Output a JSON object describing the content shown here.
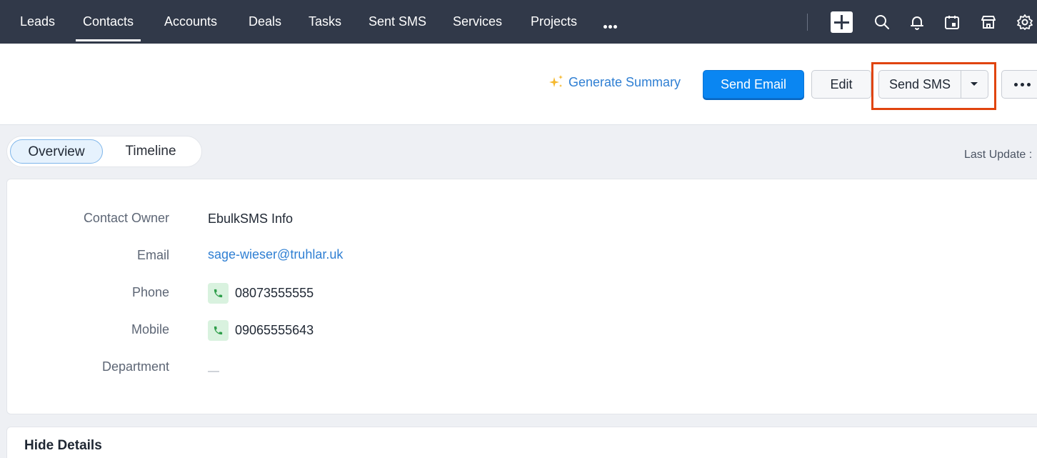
{
  "nav": {
    "items": [
      {
        "label": "Leads",
        "active": false
      },
      {
        "label": "Contacts",
        "active": true
      },
      {
        "label": "Accounts",
        "active": false
      },
      {
        "label": "Deals",
        "active": false
      },
      {
        "label": "Tasks",
        "active": false
      },
      {
        "label": "Sent SMS",
        "active": false
      },
      {
        "label": "Services",
        "active": false
      },
      {
        "label": "Projects",
        "active": false
      }
    ],
    "icons": [
      "plus-icon",
      "search-icon",
      "bell-icon",
      "calendar-icon",
      "marketplace-icon",
      "gear-icon"
    ]
  },
  "header": {
    "generate_summary": "Generate Summary",
    "send_email": "Send Email",
    "edit": "Edit",
    "send_sms": "Send SMS"
  },
  "tabs": {
    "overview": "Overview",
    "timeline": "Timeline"
  },
  "last_update_label": "Last Update :",
  "details": {
    "contact_owner": {
      "label": "Contact Owner",
      "value": "EbulkSMS Info"
    },
    "email": {
      "label": "Email",
      "value": "sage-wieser@truhlar.uk"
    },
    "phone": {
      "label": "Phone",
      "value": "08073555555"
    },
    "mobile": {
      "label": "Mobile",
      "value": "09065555643"
    },
    "department": {
      "label": "Department",
      "value": "—"
    }
  },
  "hide_details": "Hide Details",
  "colors": {
    "nav_bg": "#313949",
    "primary": "#0a86f2",
    "link": "#2f7fd3",
    "highlight": "#e0440e"
  }
}
